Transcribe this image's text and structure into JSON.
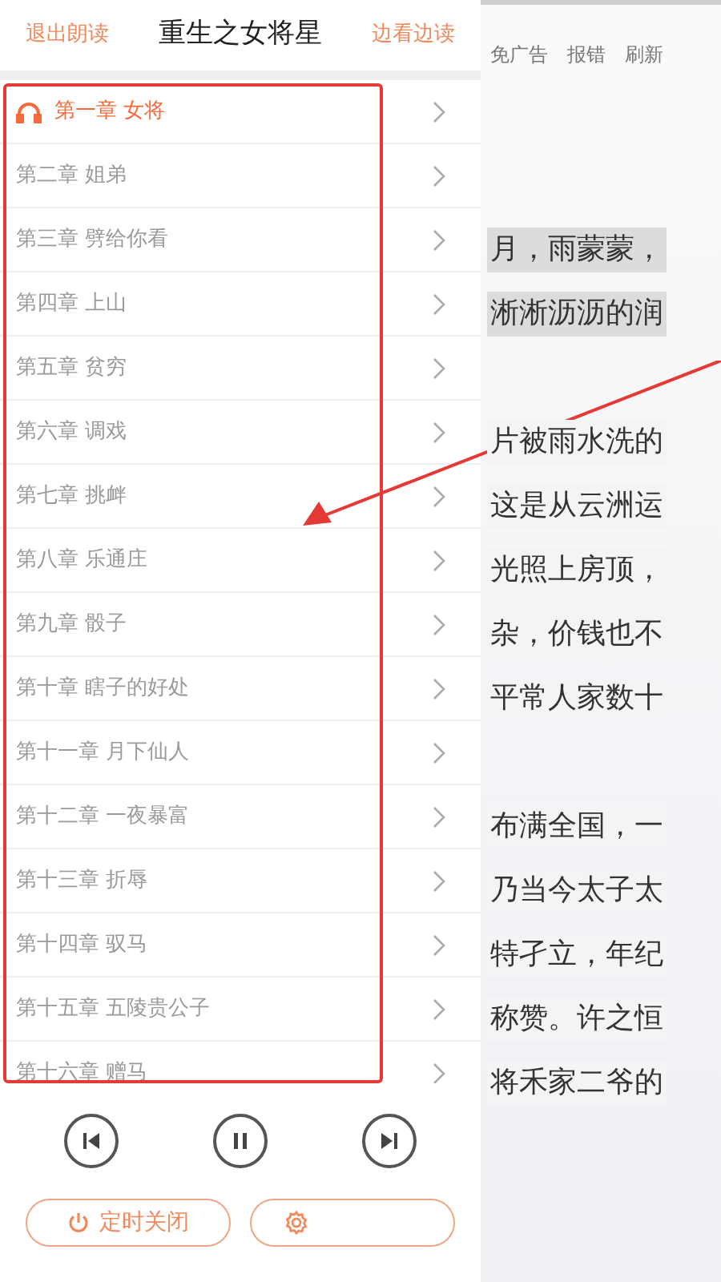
{
  "panel": {
    "exit_label": "退出朗读",
    "title": "重生之女将星",
    "browse_label": "边看边读"
  },
  "chapters": [
    {
      "title": "第一章 女将",
      "selected": true
    },
    {
      "title": "第二章 姐弟",
      "selected": false
    },
    {
      "title": "第三章 劈给你看",
      "selected": false
    },
    {
      "title": "第四章 上山",
      "selected": false
    },
    {
      "title": "第五章 贫穷",
      "selected": false
    },
    {
      "title": "第六章 调戏",
      "selected": false
    },
    {
      "title": "第七章 挑衅",
      "selected": false
    },
    {
      "title": "第八章 乐通庄",
      "selected": false
    },
    {
      "title": "第九章 骰子",
      "selected": false
    },
    {
      "title": "第十章 瞎子的好处",
      "selected": false
    },
    {
      "title": "第十一章 月下仙人",
      "selected": false
    },
    {
      "title": "第十二章 一夜暴富",
      "selected": false
    },
    {
      "title": "第十三章 折辱",
      "selected": false
    },
    {
      "title": "第十四章 驭马",
      "selected": false
    },
    {
      "title": "第十五章 五陵贵公子",
      "selected": false
    },
    {
      "title": "第十六章 赠马",
      "selected": false
    }
  ],
  "timer_button": "定时关闭",
  "reader": {
    "actions": [
      "免广告",
      "报错",
      "刷新"
    ],
    "paragraphs": [
      {
        "highlighted": true,
        "lines": [
          "月，雨蒙蒙，",
          "淅淅沥沥的润"
        ]
      },
      {
        "highlighted": false,
        "lines": [
          "片被雨水洗的",
          "这是从云洲运",
          "光照上房顶，",
          "杂，价钱也不",
          "平常人家数十"
        ]
      },
      {
        "highlighted": false,
        "lines": [
          "布满全国，一",
          "乃当今太子太",
          "特孑立，年纪",
          "称赞。许之恒",
          "将禾家二爷的"
        ]
      }
    ]
  }
}
